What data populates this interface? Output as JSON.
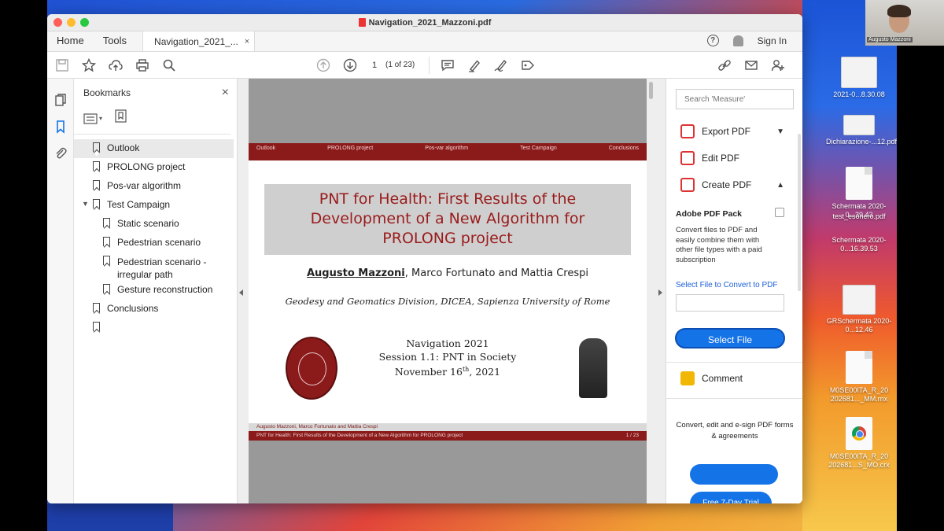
{
  "window": {
    "title": "Navigation_2021_Mazzoni.pdf"
  },
  "menubar": {
    "home": "Home",
    "tools": "Tools",
    "doc_tab": "Navigation_2021_...",
    "doc_tab_close": "×",
    "signin": "Sign In",
    "help": "?"
  },
  "toolbar": {
    "page_value": "1",
    "page_count": "(1 of 23)"
  },
  "bookmarks": {
    "title": "Bookmarks",
    "close": "×",
    "items": [
      {
        "label": "Outlook"
      },
      {
        "label": "PROLONG project"
      },
      {
        "label": "Pos-var algorithm"
      },
      {
        "label": "Test Campaign"
      },
      {
        "label": "Static scenario"
      },
      {
        "label": "Pedestrian scenario"
      },
      {
        "label": "Pedestrian scenario -"
      },
      {
        "label": "irregular path"
      },
      {
        "label": "Gesture reconstruction"
      },
      {
        "label": "Conclusions"
      }
    ]
  },
  "slide": {
    "nav": [
      "Outlook",
      "PROLONG project",
      "Pos-var algorithm",
      "Test Campaign",
      "Conclusions"
    ],
    "title_line1": "PNT for Health: First Results of the",
    "title_line2": "Development of a New Algorithm for",
    "title_line3": "PROLONG project",
    "author_main": "Augusto Mazzoni",
    "authors_rest": ", Marco Fortunato and Mattia Crespi",
    "affiliation": "Geodesy and Geomatics Division, DICEA, Sapienza University of Rome",
    "event": "Navigation 2021",
    "session": "Session 1.1: PNT in Society",
    "date_pre": "November 16",
    "date_sup": "th",
    "date_post": ", 2021",
    "footer_authors": "Augusto Mazzoni, Marco Fortunato and Mattia Crespi",
    "footer_title": "PNT for Health: First Results of the Development of a New Algorithm for PROLONG project",
    "footer_page": "1 / 23"
  },
  "rightpane": {
    "search_placeholder": "Search 'Measure'",
    "export_pdf": "Export PDF",
    "edit_pdf": "Edit PDF",
    "create_pdf": "Create PDF",
    "pack_title": "Adobe PDF Pack",
    "pack_desc": "Convert files to PDF and easily combine them with other file types with a paid subscription",
    "select_label": "Select File to Convert to PDF",
    "select_button": "Select File",
    "comment": "Comment",
    "convert_text": "Convert, edit and e-sign PDF forms & agreements",
    "trial": "Free 7-Day Trial"
  },
  "desktop": {
    "icons": [
      "2021-0...8.30.08",
      "Dichiarazione-...12.pdf",
      "Schermata 2020-0...39.43",
      "test_esonero.pdf",
      "Schermata 2020-0...16.39.53",
      "GRSchermata 2020-0...12.46",
      "M0SE00ITA_R_20 202681..._MM.rnx",
      "M0SE00ITA_R_20 202681...S_MO.crx"
    ],
    "webcam_name": "Augusto Mazzoni"
  },
  "colors": {
    "beamer_red": "#8b1a1a",
    "acrobat_blue": "#1473e6"
  }
}
